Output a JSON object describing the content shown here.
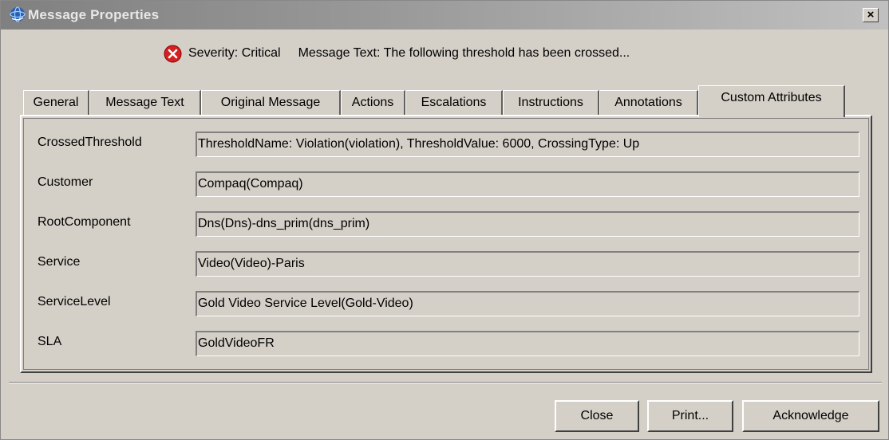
{
  "window": {
    "title": "Message Properties",
    "close_label": "×"
  },
  "severity": {
    "label": "Severity: Critical",
    "message": "Message Text: The following threshold has been crossed..."
  },
  "tabs": [
    {
      "label": "General"
    },
    {
      "label": "Message Text"
    },
    {
      "label": "Original Message"
    },
    {
      "label": "Actions"
    },
    {
      "label": "Escalations"
    },
    {
      "label": "Instructions"
    },
    {
      "label": "Annotations"
    },
    {
      "label": "Custom Attributes",
      "active": true
    }
  ],
  "attributes": [
    {
      "name": "CrossedThreshold",
      "value": "ThresholdName: Violation(violation), ThresholdValue: 6000, CrossingType: Up"
    },
    {
      "name": "Customer",
      "value": "Compaq(Compaq)"
    },
    {
      "name": "RootComponent",
      "value": "Dns(Dns)-dns_prim(dns_prim)"
    },
    {
      "name": "Service",
      "value": "Video(Video)-Paris"
    },
    {
      "name": "ServiceLevel",
      "value": "Gold Video Service Level(Gold-Video)"
    },
    {
      "name": "SLA",
      "value": "GoldVideoFR"
    }
  ],
  "buttons": {
    "close": "Close",
    "print": "Print...",
    "acknowledge": "Acknowledge"
  },
  "colors": {
    "critical": "#d42020",
    "window_bg": "#d4d0c8"
  },
  "icons": {
    "app": "app-globe-icon",
    "severity": "critical-x-icon"
  }
}
